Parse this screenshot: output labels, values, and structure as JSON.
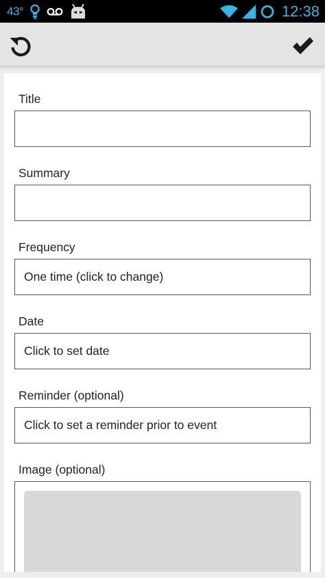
{
  "status_bar": {
    "temperature": "43°",
    "time": "12:38",
    "icons": [
      "lightbulb-icon",
      "voicemail-icon",
      "android-icon",
      "wifi-icon",
      "signal-icon",
      "sync-circle-icon"
    ]
  },
  "action_bar": {
    "icons": {
      "left": "refresh-icon",
      "right": "checkmark-icon"
    }
  },
  "form": {
    "title_label": "Title",
    "title_value": "",
    "summary_label": "Summary",
    "summary_value": "",
    "frequency_label": "Frequency",
    "frequency_value": "One time (click to change)",
    "date_label": "Date",
    "date_value": "Click to set date",
    "reminder_label": "Reminder (optional)",
    "reminder_value": "Click to set a reminder prior to event",
    "image_label": "Image (optional)"
  },
  "colors": {
    "status_accent": "#33b5e5",
    "status_background": "#000000",
    "action_bar_background": "#e4e4e4",
    "border": "#555555",
    "image_placeholder": "#d8d8d8"
  }
}
